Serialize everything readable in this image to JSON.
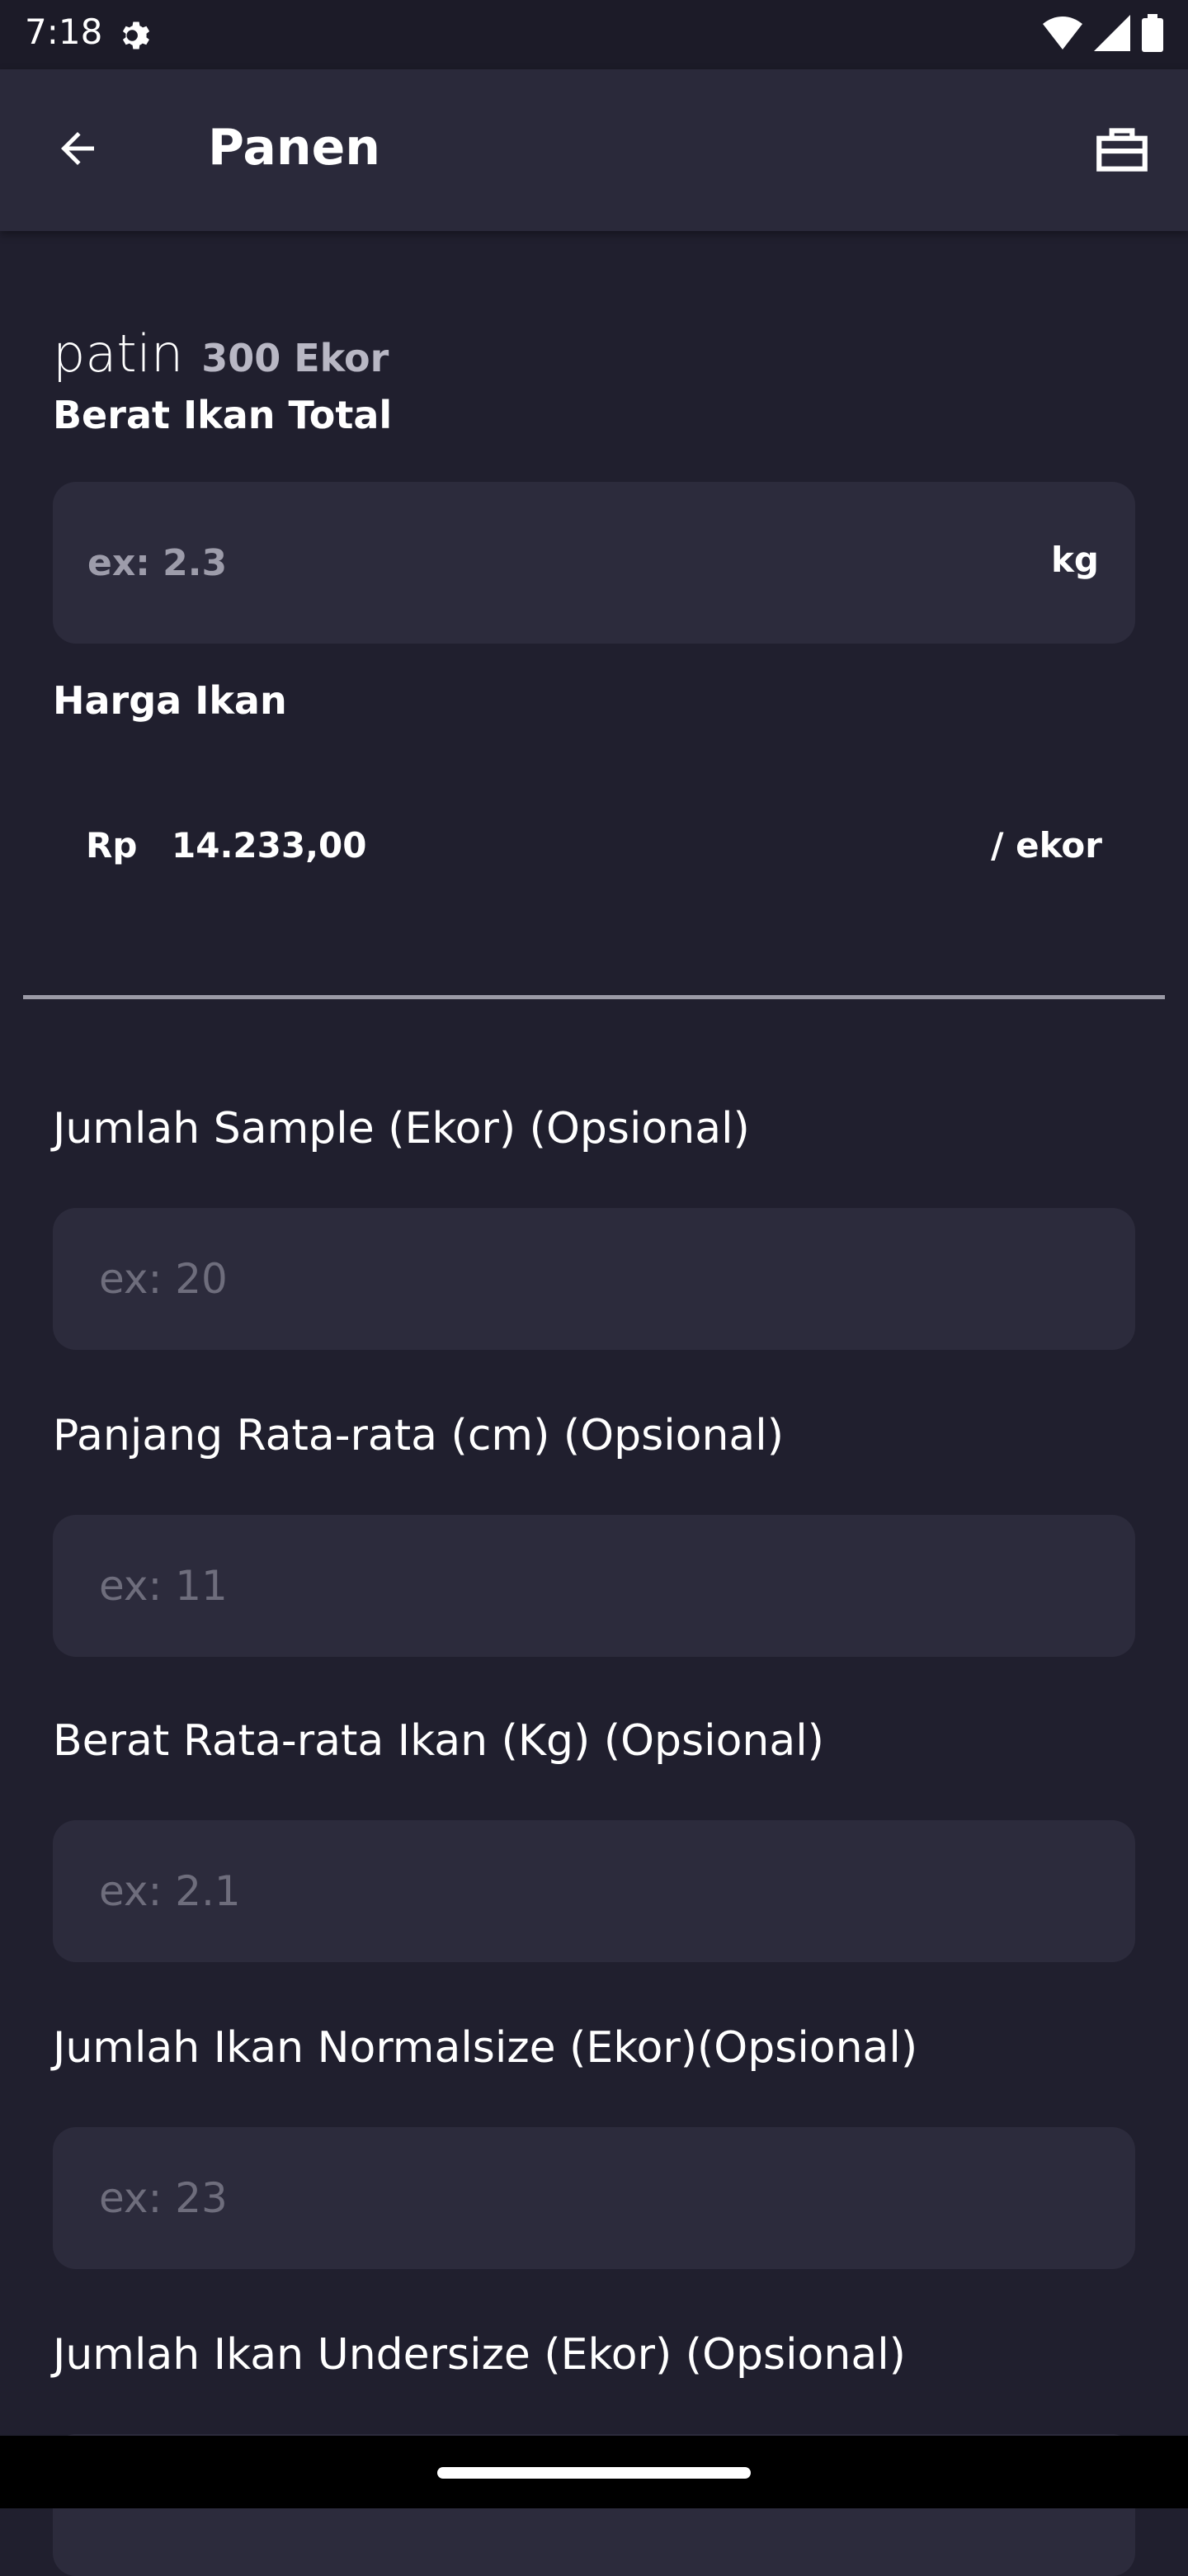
{
  "status_bar": {
    "time": "7:18"
  },
  "app_bar": {
    "title": "Panen"
  },
  "fish": {
    "name": "patin",
    "count": "300 Ekor"
  },
  "weight_total": {
    "label": "Berat Ikan Total",
    "placeholder": "ex: 2.3",
    "unit": "kg"
  },
  "price": {
    "label": "Harga Ikan",
    "currency": "Rp",
    "value": "14.233,00",
    "unit": "/ ekor"
  },
  "optional_fields": [
    {
      "label": "Jumlah Sample (Ekor) (Opsional)",
      "placeholder": "ex: 20"
    },
    {
      "label": "Panjang Rata-rata (cm) (Opsional)",
      "placeholder": "ex: 11"
    },
    {
      "label": "Berat Rata-rata Ikan (Kg) (Opsional)",
      "placeholder": "ex: 2.1"
    },
    {
      "label": "Jumlah Ikan Normalsize (Ekor)(Opsional)",
      "placeholder": "ex: 23"
    },
    {
      "label": "Jumlah Ikan Undersize (Ekor) (Opsional)",
      "placeholder": ""
    }
  ]
}
